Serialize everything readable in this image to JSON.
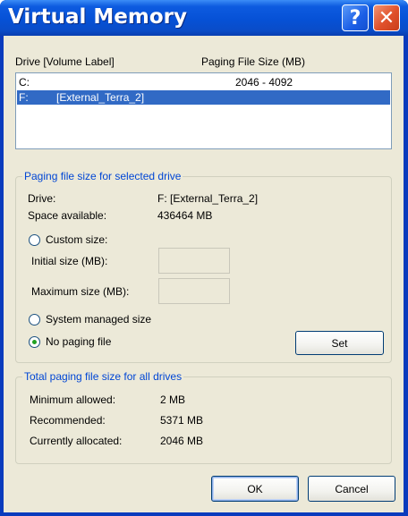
{
  "window": {
    "title": "Virtual Memory",
    "help_glyph": "?",
    "close_glyph": "✕"
  },
  "drive_list": {
    "header_drive": "Drive  [Volume Label]",
    "header_size": "Paging File Size (MB)",
    "rows": [
      {
        "drive": "C:",
        "label": "",
        "size": "2046 - 4092",
        "selected": false
      },
      {
        "drive": "F:",
        "label": "[External_Terra_2]",
        "size": "",
        "selected": true
      }
    ]
  },
  "selected_drive_group": {
    "title": "Paging file size for selected drive",
    "drive_label": "Drive:",
    "drive_value": "F:  [External_Terra_2]",
    "space_label": "Space available:",
    "space_value": "436464 MB",
    "custom_size_label": "Custom size:",
    "custom_size_checked": false,
    "initial_size_label": "Initial size (MB):",
    "initial_size_value": "",
    "maximum_size_label": "Maximum size (MB):",
    "maximum_size_value": "",
    "system_managed_label": "System managed size",
    "system_managed_checked": false,
    "no_paging_label": "No paging file",
    "no_paging_checked": true,
    "set_button": "Set"
  },
  "totals_group": {
    "title": "Total paging file size for all drives",
    "min_label": "Minimum allowed:",
    "min_value": "2 MB",
    "recommended_label": "Recommended:",
    "recommended_value": "5371 MB",
    "allocated_label": "Currently allocated:",
    "allocated_value": "2046 MB"
  },
  "footer": {
    "ok_button": "OK",
    "cancel_button": "Cancel"
  },
  "colors": {
    "titlebar": "#0651d6",
    "selection": "#316ac5",
    "group_title": "#0046d5",
    "radio_dot": "#21a121"
  }
}
